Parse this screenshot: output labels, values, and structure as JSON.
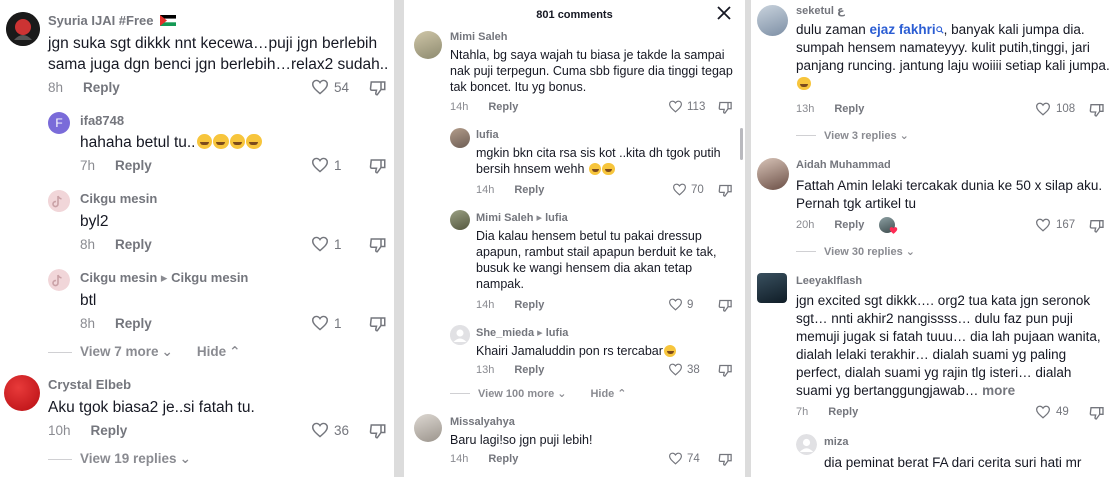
{
  "panel1": {
    "comments": [
      {
        "user": "Syuria IJAI #Free",
        "text": "jgn suka sgt dikkk nnt kecewa…puji jgn berlebih sama juga dgn benci jgn berlebih…relax2 sudah..",
        "time": "8h",
        "reply": "Reply",
        "likes": "54"
      },
      {
        "user": "ifa8748",
        "text": "hahaha betul tu..",
        "time": "7h",
        "reply": "Reply",
        "likes": "1",
        "avatar_letter": "F"
      },
      {
        "user": "Cikgu mesin",
        "text": "byl2",
        "time": "8h",
        "reply": "Reply",
        "likes": "1"
      },
      {
        "user": "Cikgu mesin",
        "reply_to": "Cikgu mesin",
        "text": "btl",
        "time": "8h",
        "reply": "Reply",
        "likes": "1"
      },
      {
        "user": "Crystal Elbeb",
        "text": "Aku tgok biasa2 je..si fatah tu.",
        "time": "10h",
        "reply": "Reply",
        "likes": "36"
      }
    ],
    "view_more": "View 7 more",
    "hide": "Hide",
    "view_replies": "View 19 replies"
  },
  "panel2": {
    "header": "801 comments",
    "comments": [
      {
        "user": "Mimi Saleh",
        "text": "Ntahla, bg saya wajah tu biasa je takde la sampai nak puji terpegun. Cuma sbb figure dia tinggi tegap tak boncet. Itu yg bonus.",
        "time": "14h",
        "reply": "Reply",
        "likes": "113"
      },
      {
        "user": "lufia",
        "text": "mgkin bkn cita rsa sis kot ..kita dh tgok putih bersih hnsem wehh",
        "time": "14h",
        "reply": "Reply",
        "likes": "70"
      },
      {
        "user": "Mimi Saleh",
        "reply_to": "lufia",
        "text": "Dia kalau hensem betul tu pakai dressup apapun, rambut stail apapun berduit ke tak, busuk ke wangi hensem dia akan tetap nampak.",
        "time": "14h",
        "reply": "Reply",
        "likes": "9"
      },
      {
        "user": "She_mieda",
        "reply_to": "lufia",
        "text": "Khairi Jamaluddin pon rs tercabar",
        "time": "13h",
        "reply": "Reply",
        "likes": "38"
      },
      {
        "user": "Missalyahya",
        "text": "Baru lagi!so jgn puji lebih!",
        "time": "14h",
        "reply": "Reply",
        "likes": "74"
      }
    ],
    "view_more": "View 100 more",
    "hide": "Hide"
  },
  "panel3": {
    "comments": [
      {
        "user": "seketul",
        "user_suffix": "ع",
        "text_pre": "dulu zaman ",
        "mention": "ejaz fakhri",
        "text": ", banyak kali jumpa dia. sumpah hensem namateyyy. kulit putih,tinggi, jari panjang runcing. jantung laju woiiii setiap kali jumpa.",
        "time": "13h",
        "reply": "Reply",
        "likes": "108"
      },
      {
        "user": "Aidah Muhammad",
        "text": "Fattah Amin lelaki tercakak dunia ke 50 x silap aku. Pernah tgk artikel tu",
        "time": "20h",
        "reply": "Reply",
        "likes": "167"
      },
      {
        "user": "Leeyaklflash",
        "text": "jgn excited sgt dikkk…. org2 tua kata jgn seronok sgt… nnti akhir2 nangissss… dulu faz pun puji memuji jugak si fatah tuuu… dia lah pujaan wanita, dialah lelaki terakhir… dialah suami yg paling perfect, dialah suami yg rajin tlg isteri… dialah suami yg bertanggungjawab…",
        "more": "more",
        "time": "7h",
        "reply": "Reply",
        "likes": "49"
      },
      {
        "user": "miza",
        "text": "dia peminat berat FA dari cerita suri hati mr",
        "time": "",
        "reply": "",
        "likes": ""
      }
    ],
    "view_replies_1": "View 3 replies",
    "view_replies_2": "View 30 replies"
  },
  "colors": {
    "text": "#161823",
    "muted": "#8a8b91",
    "mention": "#2b5dd3"
  }
}
